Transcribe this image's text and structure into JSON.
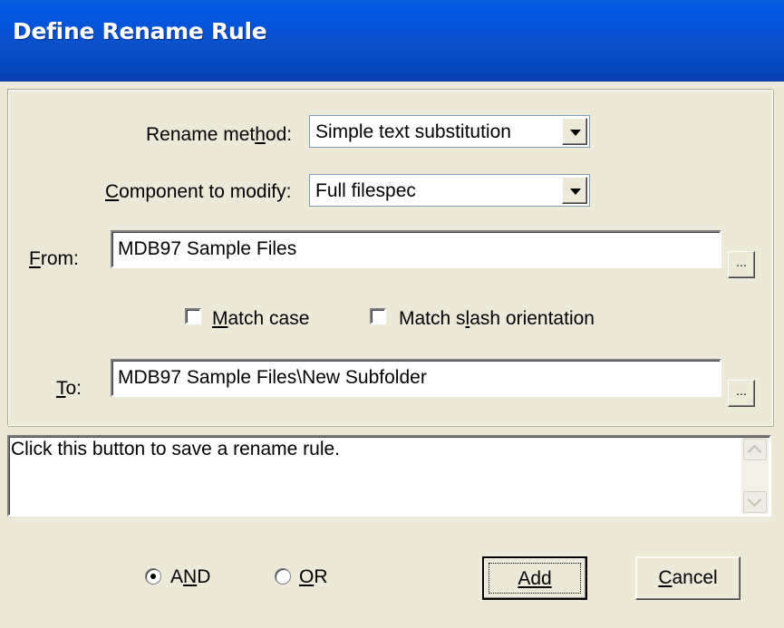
{
  "window": {
    "title": "Define Rename Rule"
  },
  "rename_method": {
    "label": "Rename method:",
    "value": "Simple text substitution"
  },
  "component": {
    "label": "Component to modify:",
    "value": "Full filespec"
  },
  "from_field": {
    "label": "From:",
    "value": "MDB97 Sample Files",
    "browse_label": "..."
  },
  "to_field": {
    "label": "To:",
    "value": "MDB97 Sample Files\\New Subfolder",
    "browse_label": "..."
  },
  "options": {
    "match_case": {
      "label": "Match case",
      "checked": false
    },
    "match_slash": {
      "label": "Match slash orientation",
      "checked": false
    }
  },
  "help_text": "Click this button to save a rename rule.",
  "logic": {
    "and_label": "AND",
    "or_label": "OR",
    "selected": "AND"
  },
  "buttons": {
    "add": "Add",
    "cancel": "Cancel"
  }
}
